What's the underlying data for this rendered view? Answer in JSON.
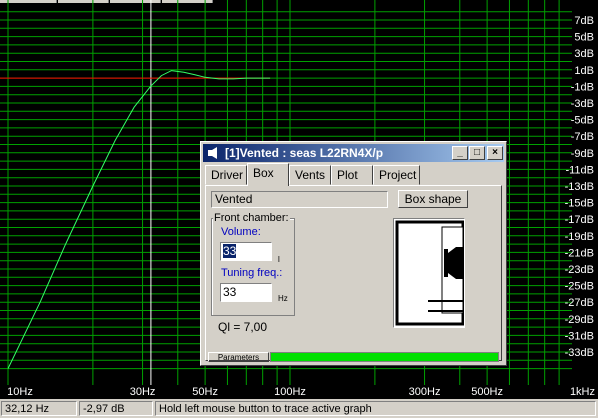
{
  "colors": {
    "grid": "#00a000",
    "curve": "#33ff66",
    "reference_line": "#ff0000",
    "background": "#000000",
    "title_bar": "#0a246a"
  },
  "chart_data": {
    "type": "line",
    "x_scale": "log",
    "x_range": [
      10,
      1000
    ],
    "y_range": [
      -35,
      8
    ],
    "x_tick_labels": [
      {
        "x": 10,
        "label": "10Hz"
      },
      {
        "x": 30,
        "label": "30Hz"
      },
      {
        "x": 50,
        "label": "50Hz"
      },
      {
        "x": 100,
        "label": "100Hz"
      },
      {
        "x": 300,
        "label": "300Hz"
      },
      {
        "x": 500,
        "label": "500Hz"
      },
      {
        "x": 1000,
        "label": "1kHz"
      }
    ],
    "y_tick_labels": [
      "7dB",
      "5dB",
      "3dB",
      "1dB",
      "-1dB",
      "-3dB",
      "-5dB",
      "-7dB",
      "-9dB",
      "-11dB",
      "-13dB",
      "-15dB",
      "-17dB",
      "-19dB",
      "-21dB",
      "-23dB",
      "-25dB",
      "-27dB",
      "-29dB",
      "-31dB",
      "-33dB"
    ],
    "grid": true,
    "reference_line": {
      "y": 0,
      "x_start": 10,
      "x_end": 85
    },
    "cursor_x": 32.12,
    "series": [
      {
        "x": [
          10,
          13,
          16,
          20,
          24,
          28,
          32,
          35,
          38,
          42,
          46,
          50,
          56,
          63,
          70,
          80,
          85
        ],
        "y": [
          -35,
          -27,
          -20,
          -13,
          -7.5,
          -3.5,
          -1,
          0.3,
          0.9,
          0.7,
          0.4,
          0.1,
          -0.1,
          -0.1,
          0,
          0,
          0
        ]
      }
    ]
  },
  "status_bar": {
    "freq": "32,12 Hz",
    "level": "-2,97 dB",
    "hint": "Hold left mouse button to trace active graph"
  },
  "dialog": {
    "title": "[1]Vented : seas L22RN4X/p",
    "tabs": [
      "Driver",
      "Box",
      "Vents",
      "Plot",
      "Project"
    ],
    "active_tab": "Box",
    "box_type": "Vented",
    "box_shape_button": "Box shape",
    "front_chamber_label": "Front chamber:",
    "volume_label": "Volume:",
    "volume_value": "33",
    "volume_unit": "l",
    "tuning_label": "Tuning freq.:",
    "tuning_value": "33",
    "tuning_unit": "Hz",
    "ql": "Ql = 7,00",
    "parameters_label": "Parameters"
  }
}
